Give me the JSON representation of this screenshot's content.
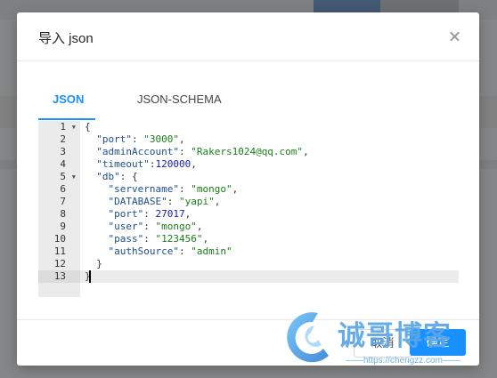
{
  "modal": {
    "title": "导入 json",
    "tabs": [
      {
        "label": "JSON",
        "active": true
      },
      {
        "label": "JSON-SCHEMA",
        "active": false
      }
    ],
    "editor": {
      "line_numbers": [
        "1",
        "2",
        "3",
        "4",
        "5",
        "6",
        "7",
        "8",
        "9",
        "10",
        "11",
        "12",
        "13"
      ],
      "fold_lines": [
        1,
        5
      ],
      "active_line": 13,
      "lines": [
        "{",
        "  \"port\": \"3000\",",
        "  \"adminAccount\": \"Rakers1024@qq.com\",",
        "  \"timeout\":120000,",
        "  \"db\": {",
        "    \"servername\": \"mongo\",",
        "    \"DATABASE\": \"yapi\",",
        "    \"port\": 27017,",
        "    \"user\": \"mongo\",",
        "    \"pass\": \"123456\",",
        "    \"authSource\": \"admin\"",
        "  }",
        "}"
      ]
    },
    "footer": {
      "cancel_label": "取消",
      "ok_label": "确定"
    }
  },
  "watermark": {
    "text": "诚哥博客",
    "url": "——https://chengzz.com——"
  },
  "colors": {
    "accent": "#1890ff",
    "string": "#1a7e1a",
    "key": "#224f8c",
    "number": "#1a1aa6"
  }
}
